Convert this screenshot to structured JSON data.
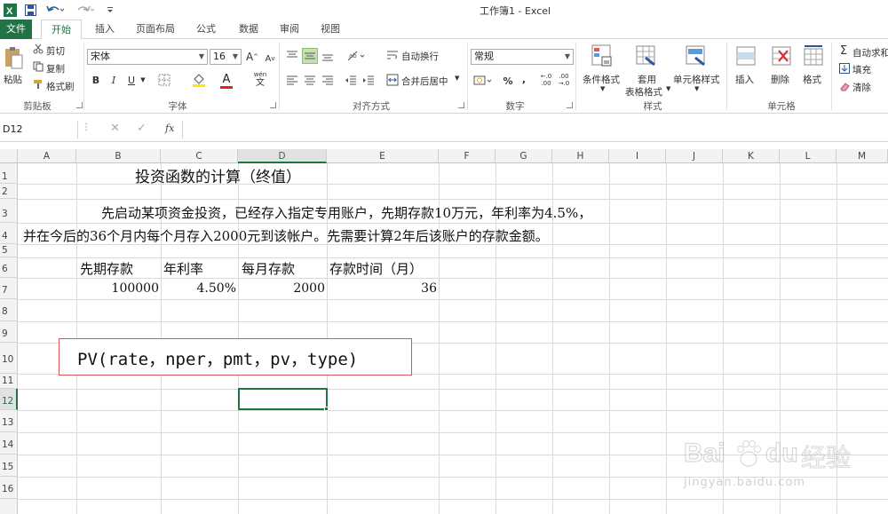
{
  "title": "工作簿1 - Excel",
  "tabs": [
    "文件",
    "开始",
    "插入",
    "页面布局",
    "公式",
    "数据",
    "审阅",
    "视图"
  ],
  "ribbon": {
    "clipboard": {
      "paste": "粘贴",
      "cut": "剪切",
      "copy": "复制",
      "painter": "格式刷",
      "label": "剪贴板"
    },
    "font": {
      "name": "宋体",
      "size": "16",
      "label": "字体",
      "grow": "A",
      "shrink": "A",
      "bold": "B",
      "italic": "I",
      "underline": "U",
      "color_a": "A",
      "wen": "wén",
      "wen_char": "文"
    },
    "align": {
      "wrap": "自动换行",
      "merge": "合并后居中",
      "label": "对齐方式"
    },
    "number": {
      "format": "常规",
      "pct": "%",
      "comma": ",",
      "label": "数字",
      "inc": "←.0\n.00",
      "dec": ".00\n→.0"
    },
    "styles": {
      "cond": "条件格式",
      "table1": "套用",
      "table2": "表格格式",
      "cell": "单元格样式",
      "label": "样式"
    },
    "cells": {
      "insert": "插入",
      "delete": "删除",
      "format": "格式",
      "label": "单元格"
    },
    "editing": {
      "autosum": "自动求和",
      "fill": "填充",
      "clear": "清除"
    }
  },
  "formula_bar": {
    "namebox": "D12",
    "fx": "fx",
    "value": ""
  },
  "columns": [
    "A",
    "B",
    "C",
    "D",
    "E",
    "F",
    "G",
    "H",
    "I",
    "J",
    "K",
    "L",
    "M"
  ],
  "rows": [
    "1",
    "2",
    "3",
    "4",
    "5",
    "6",
    "7",
    "8",
    "9",
    "10",
    "11",
    "12",
    "13",
    "14",
    "15",
    "16"
  ],
  "sheet": {
    "title": "投资函数的计算（终值）",
    "para1": "先启动某项资金投资，已经存入指定专用账户，先期存款10万元，年利率为4.5%，",
    "para2": "并在今后的36个月内每个月存入2000元到该帐户。先需要计算2年后该账户的存款金额。",
    "headers": [
      "先期存款",
      "年利率",
      "每月存款",
      "存款时间（月）"
    ],
    "values": [
      "100000",
      "4.50%",
      "2000",
      "36"
    ],
    "formula": "PV(rate，nper，pmt，pv，type)"
  },
  "watermark": {
    "brand": "Bai",
    "brand2": "du",
    "cn": "经验",
    "url": "jingyan.baidu.com"
  },
  "colors": {
    "accent": "#217346",
    "annot": "#e05555"
  }
}
